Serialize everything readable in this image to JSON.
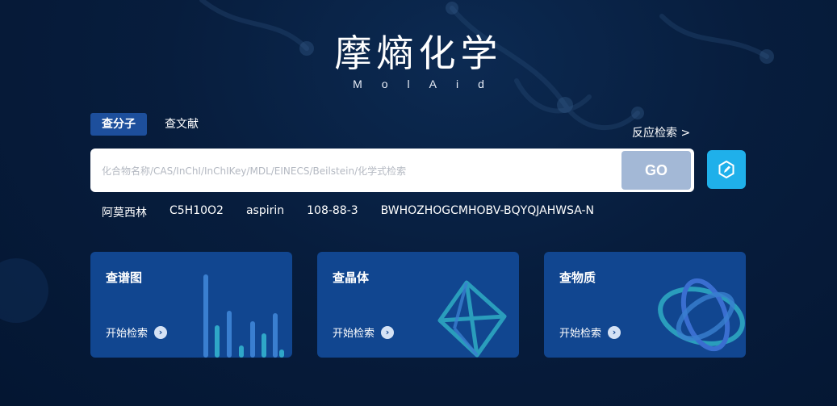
{
  "logo": {
    "title": "摩熵化学",
    "subtitle": "MolAid"
  },
  "tabs": [
    {
      "label": "查分子",
      "active": true
    },
    {
      "label": "查文献",
      "active": false
    }
  ],
  "reaction_link": "反应检索 >",
  "search": {
    "placeholder": "化合物名称/CAS/InChI/InChIKey/MDL/EINECS/Beilstein/化学式检索",
    "value": "",
    "go_label": "GO",
    "draw_icon": "edit-structure-icon"
  },
  "suggestions": [
    "阿莫西林",
    "C5H10O2",
    "aspirin",
    "108-88-3",
    "BWHOZHOGCMHOBV-BQYQJAHWSA-N"
  ],
  "cards": [
    {
      "title": "查谱图",
      "link": "开始检索",
      "icon": "spectrum-bars-icon"
    },
    {
      "title": "查晶体",
      "link": "开始检索",
      "icon": "crystal-octahedron-icon"
    },
    {
      "title": "查物质",
      "link": "开始检索",
      "icon": "atom-orbit-icon"
    }
  ],
  "colors": {
    "background": "#071d3d",
    "card": "#114690",
    "tab_active": "#1d4f9c",
    "go_button": "#a3b8d6",
    "draw_button": "#1fb0ea"
  }
}
